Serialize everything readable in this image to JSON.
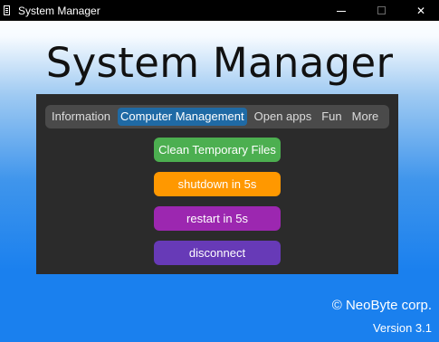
{
  "window": {
    "title": "System Manager",
    "close_glyph": "✕"
  },
  "header": {
    "title": "System Manager"
  },
  "tabs": [
    {
      "label": "Information",
      "active": false
    },
    {
      "label": "Computer Management",
      "active": true
    },
    {
      "label": "Open apps",
      "active": false
    },
    {
      "label": "Fun",
      "active": false
    },
    {
      "label": "More",
      "active": false
    }
  ],
  "actions": [
    {
      "label": "Clean Temporary Files",
      "color": "#4caf50"
    },
    {
      "label": "shutdown in 5s",
      "color": "#ff9800"
    },
    {
      "label": "restart in 5s",
      "color": "#9c27b0"
    },
    {
      "label": "disconnect",
      "color": "#673ab7"
    }
  ],
  "footer": {
    "copyright": "© NeoByte corp.",
    "version": "Version 3.1"
  },
  "colors": {
    "tab_active": "#1f6aa5",
    "panel_bg": "#2b2b2b",
    "tabbar_bg": "#4a4a4a",
    "bg_bottom": "#1a80ee"
  },
  "icons": {
    "app": "app-icon",
    "minimize": "minimize-icon",
    "maximize": "maximize-icon",
    "close": "close-icon"
  }
}
